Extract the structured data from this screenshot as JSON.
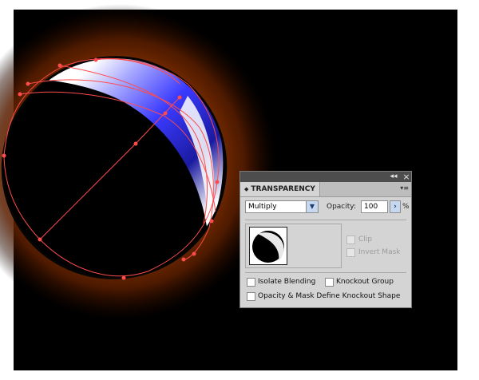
{
  "panel": {
    "tab_label": "TRANSPARENCY",
    "collapse_glyph": "◂◂",
    "close_glyph": "×",
    "menu_glyph": "▾≡",
    "blend_mode": "Multiply",
    "opacity_label": "Opacity:",
    "opacity_value": "100",
    "opacity_unit": "%",
    "clip_label": "Clip",
    "invert_mask_label": "Invert Mask",
    "isolate_blending_label": "Isolate Blending",
    "knockout_group_label": "Knockout Group",
    "opacity_mask_label": "Opacity & Mask Define Knockout Shape"
  }
}
